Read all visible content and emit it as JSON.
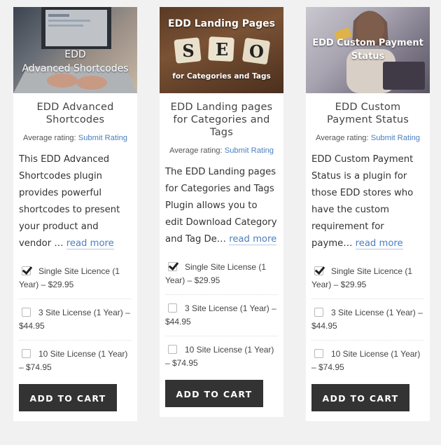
{
  "products": [
    {
      "image_text_line1": "EDD",
      "image_text_line2": "Advanced Shortcodes",
      "title": "EDD Advanced Shortcodes",
      "rating_label": "Average rating:",
      "rating_link": "Submit Rating",
      "description": "This EDD Advanced Shortcodes plugin provides powerful shortcodes to present your product and vendor …",
      "read_more": "read more",
      "options": [
        {
          "label": "Single Site Licence (1 Year) – $29.95",
          "checked": true
        },
        {
          "label": "3 Site License (1 Year) – $44.95",
          "checked": false
        },
        {
          "label": "10 Site License (1 Year) – $74.95",
          "checked": false
        }
      ],
      "button": "ADD TO CART"
    },
    {
      "image_text_line1": "EDD Landing Pages",
      "image_text_line2": "for Categories and Tags",
      "image_tiles": [
        "S",
        "E",
        "O"
      ],
      "title": "EDD Landing pages for Categories and Tags",
      "rating_label": "Average rating:",
      "rating_link": "Submit Rating",
      "description": "The EDD Landing pages for Categories and Tags Plugin allows you to edit Download Category and Tag De…",
      "read_more": "read more",
      "options": [
        {
          "label": "Single Site License (1 Year) – $29.95",
          "checked": true
        },
        {
          "label": "3 Site License (1 Year) – $44.95",
          "checked": false
        },
        {
          "label": "10 Site License (1 Year) – $74.95",
          "checked": false
        }
      ],
      "button": "ADD TO CART"
    },
    {
      "image_text_line1": "EDD Custom Payment",
      "image_text_line2": "Status",
      "title": "EDD Custom Payment Status",
      "rating_label": "Average rating:",
      "rating_link": "Submit Rating",
      "description": "EDD Custom Payment Status is a plugin for those EDD stores who have the custom requirement for payme…",
      "read_more": "read more",
      "options": [
        {
          "label": "Single Site Licence (1 Year) – $29.95",
          "checked": true
        },
        {
          "label": "3 Site License (1 Year) – $44.95",
          "checked": false
        },
        {
          "label": "10 Site License (1 Year) – $74.95",
          "checked": false
        }
      ],
      "button": "ADD TO CART"
    }
  ],
  "colors": {
    "page_bg": "#f1f1f1",
    "card_bg": "#ffffff",
    "link": "#4a7fc1",
    "button_bg": "#333333",
    "button_text": "#ffffff"
  }
}
